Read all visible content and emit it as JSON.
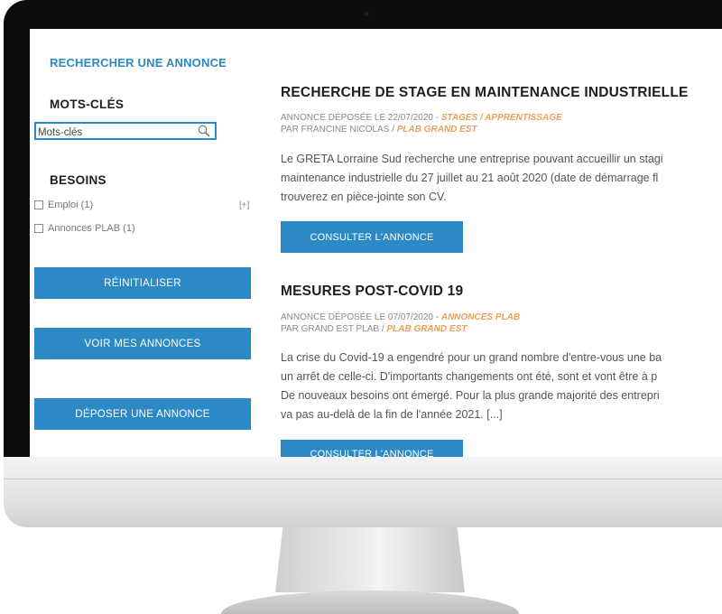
{
  "sidebar": {
    "search_heading": "RECHERCHER UNE ANNONCE",
    "keywords_heading": "MOTS-CLÉS",
    "keywords_placeholder": "Mots-clés",
    "needs_heading": "BESOINS",
    "needs_items": [
      {
        "label": "Emploi (1)",
        "checked": false
      },
      {
        "label": "Annonces PLAB (1)",
        "checked": false
      }
    ],
    "expand_label": "[+]",
    "reset_label": "RÉINITIALISER",
    "my_ads_label": "VOIR MES ANNONCES",
    "post_ad_label": "DÉPOSER UNE ANNONCE"
  },
  "listings": [
    {
      "title": "RECHERCHE DE STAGE EN MAINTENANCE INDUSTRIELLE",
      "posted_prefix": "ANNONCE DÉPOSÉE LE 22/07/2020 - ",
      "category": "STAGES / APPRENTISSAGE",
      "author_prefix": "PAR FRANCINE NICOLAS / ",
      "organization": "PLAB GRAND EST",
      "lines": [
        "Le GRETA Lorraine Sud recherche une entreprise pouvant accueillir un stagi",
        "maintenance industrielle du 27 juillet au 21 août 2020 (date de démarrage fl",
        "trouverez en pièce-jointe son CV."
      ],
      "button_label": "CONSULTER L'ANNONCE"
    },
    {
      "title": "MESURES POST-COVID 19",
      "posted_prefix": "ANNONCE DÉPOSÉE LE 07/07/2020 - ",
      "category": "ANNONCES PLAB",
      "author_prefix": "PAR GRAND EST PLAB / ",
      "organization": "PLAB GRAND EST",
      "lines": [
        "La crise du Covid-19 a engendré pour un grand nombre d'entre-vous une ba",
        "un arrêt de celle-ci. D'importants changements ont été, sont et vont être à p",
        "De nouveaux besoins ont émergé. Pour la plus grande majorité des entrepri",
        "va pas au-delà de la fin de l'année 2021. [...]"
      ],
      "button_label": "CONSULTER L'ANNONCE"
    }
  ],
  "colors": {
    "accent": "#2b8ac6",
    "category_highlight": "#e8a05a",
    "bezel": "#0d0d0d"
  }
}
